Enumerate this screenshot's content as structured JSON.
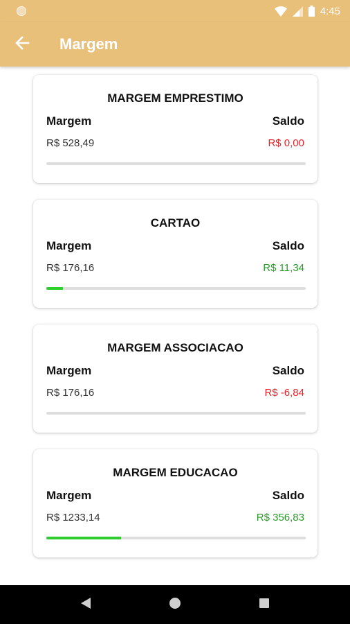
{
  "status_bar": {
    "time": "4:45"
  },
  "app_bar": {
    "title": "Margem"
  },
  "cards": [
    {
      "title": "MARGEM EMPRESTIMO",
      "left_label": "Margem",
      "right_label": "Saldo",
      "margem": "R$ 528,49",
      "saldo": "R$ 0,00",
      "saldo_status": "negative",
      "progress": 0.0
    },
    {
      "title": "CARTAO",
      "left_label": "Margem",
      "right_label": "Saldo",
      "margem": "R$ 176,16",
      "saldo": "R$ 11,34",
      "saldo_status": "positive",
      "progress": 0.064
    },
    {
      "title": "MARGEM ASSOCIACAO",
      "left_label": "Margem",
      "right_label": "Saldo",
      "margem": "R$ 176,16",
      "saldo": "R$ -6,84",
      "saldo_status": "negative",
      "progress": 0.0
    },
    {
      "title": "MARGEM EDUCACAO",
      "left_label": "Margem",
      "right_label": "Saldo",
      "margem": "R$ 1233,14",
      "saldo": "R$ 356,83",
      "saldo_status": "positive",
      "progress": 0.289
    }
  ],
  "colors": {
    "app_bar": "#e8c07a",
    "negative": "#e8232a",
    "positive": "#2a9b2a",
    "progress_fill": "#2ecc2e",
    "progress_track": "#dddddd"
  },
  "icons": {
    "back": "arrow-left-icon",
    "wifi": "wifi-icon",
    "signal": "signal-icon",
    "battery": "battery-icon",
    "nav_back": "triangle-back-icon",
    "nav_home": "circle-home-icon",
    "nav_recents": "square-recents-icon"
  }
}
